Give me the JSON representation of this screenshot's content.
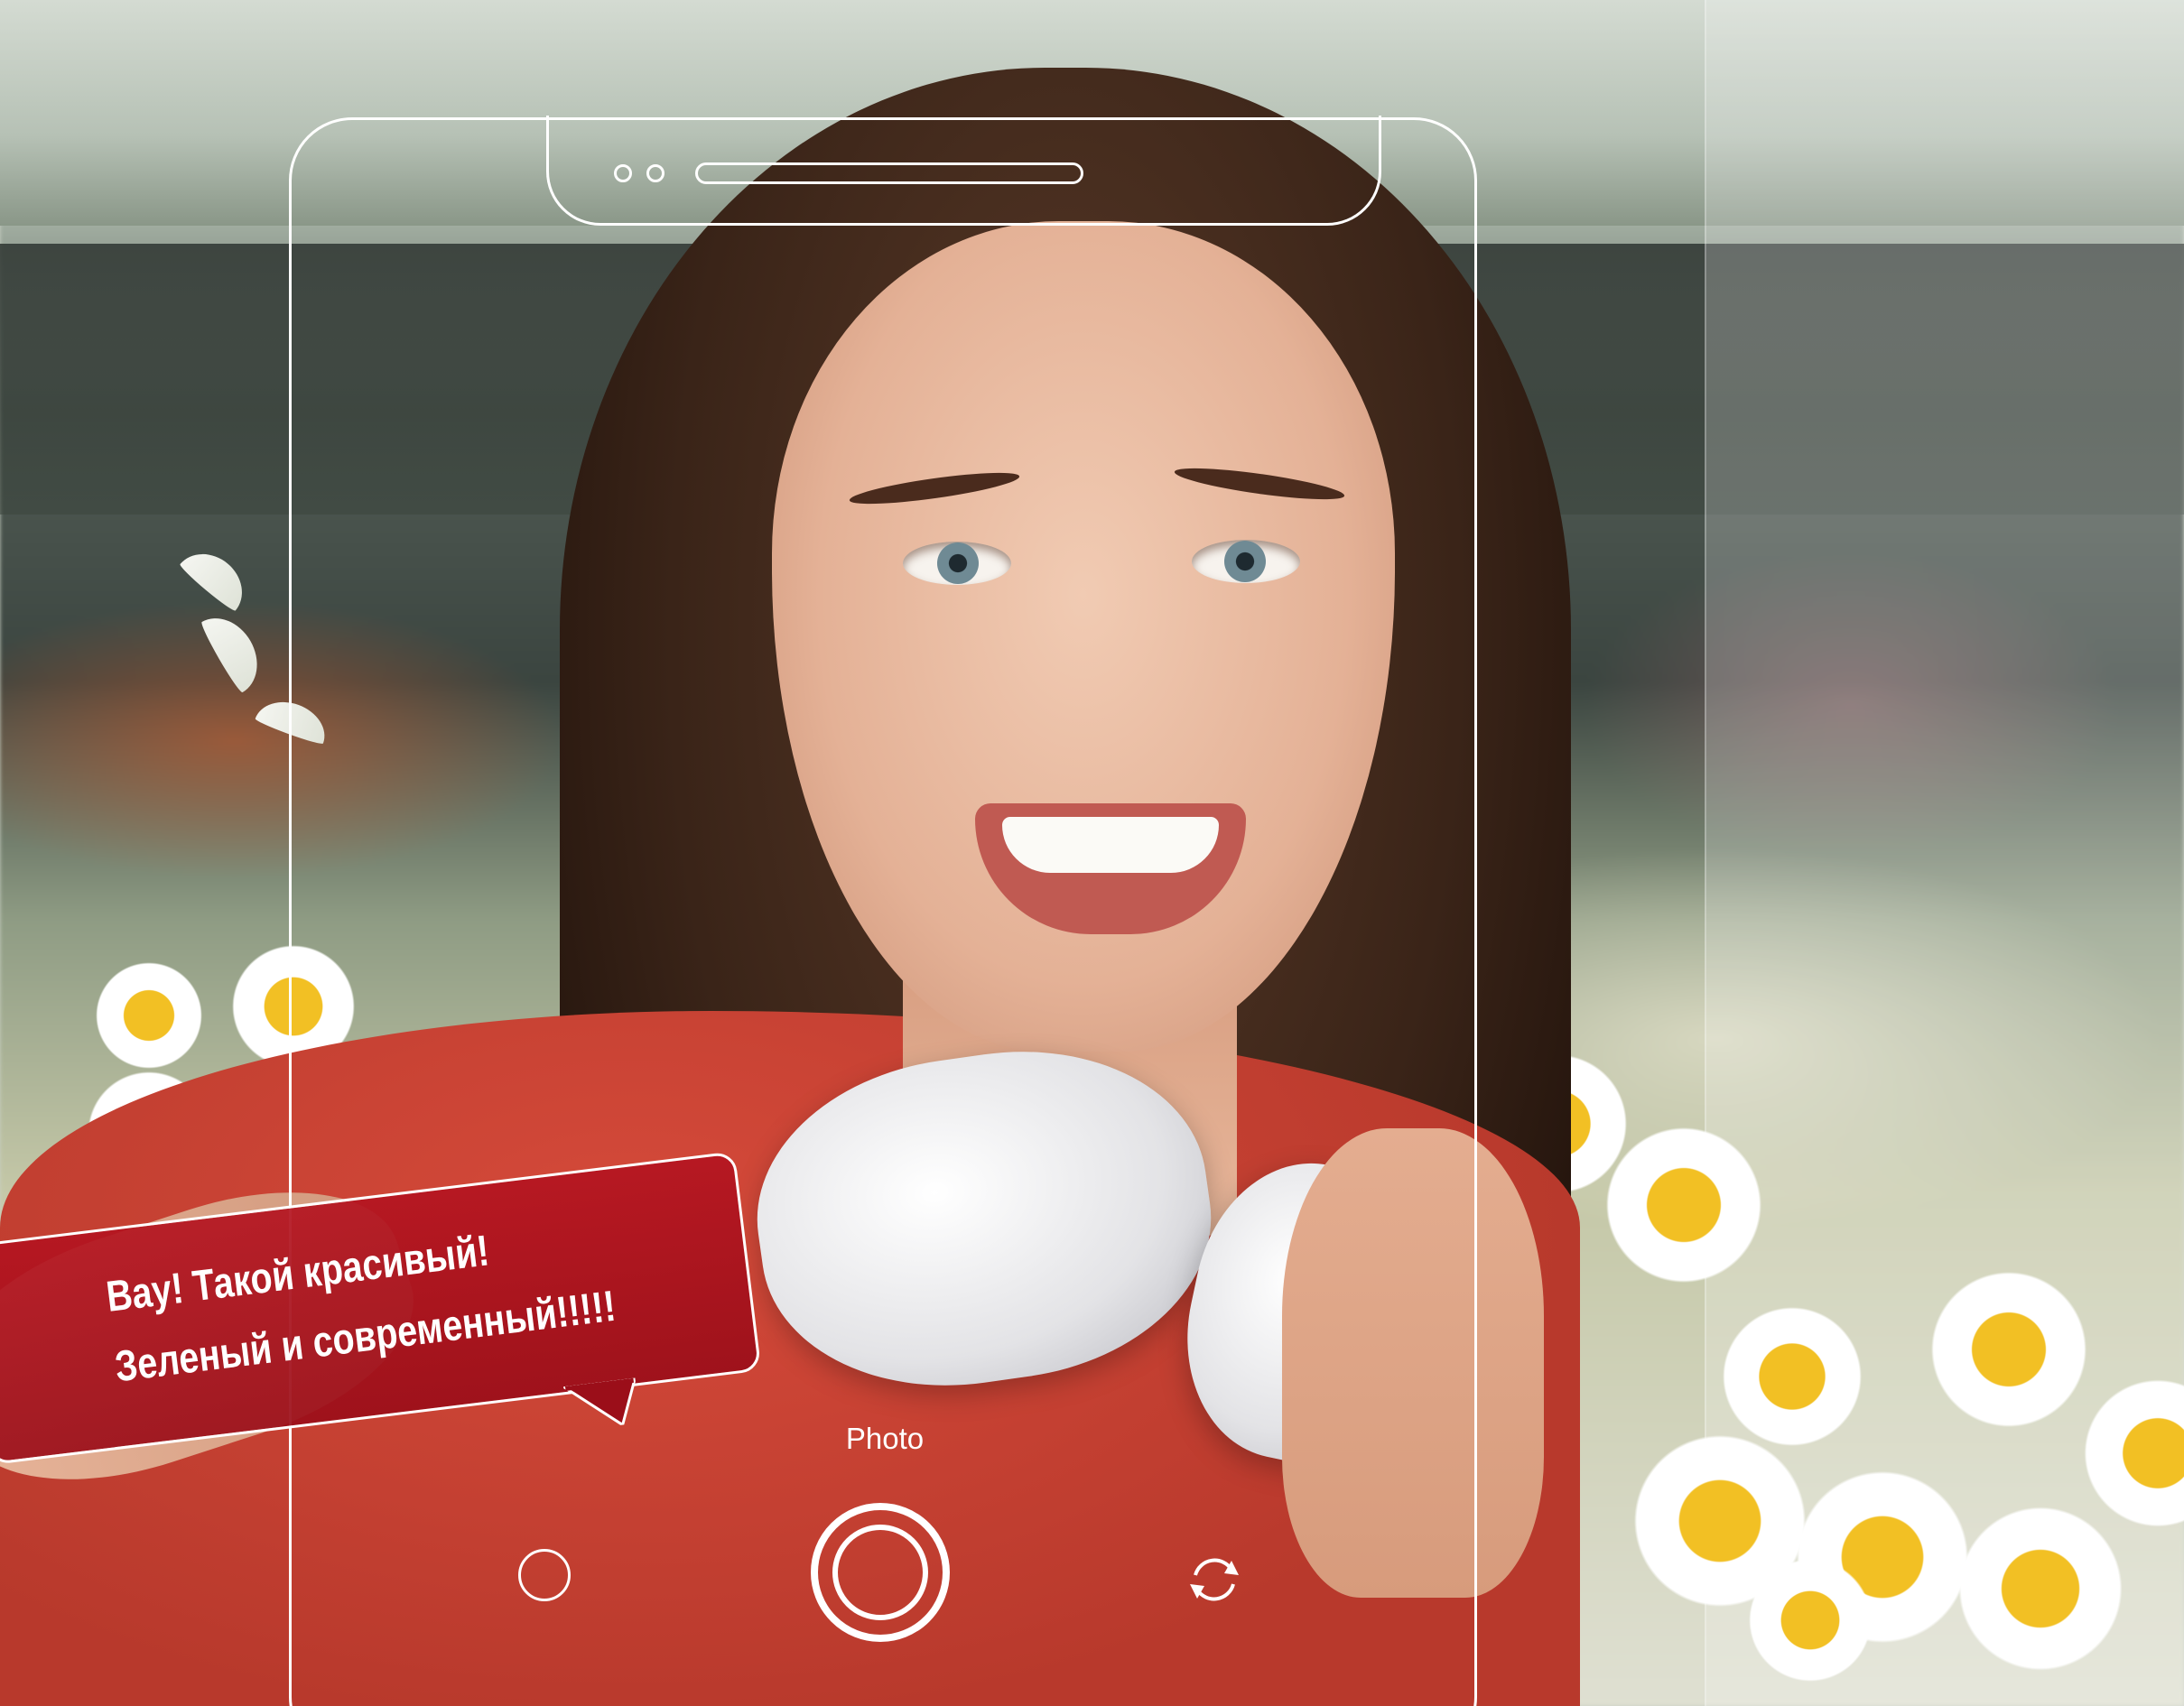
{
  "comment_bubble": {
    "line1": "Вау! Такой красивый!",
    "line2": "Зеленый и современный!!!!!",
    "color": "#b0141f"
  },
  "camera": {
    "mode_label": "Photo",
    "icons": {
      "gallery": "circle-icon",
      "shutter": "shutter-icon",
      "switch": "camera-switch-icon",
      "front_camera": "camera-dot-icon"
    }
  },
  "colors": {
    "frame": "#ffffff",
    "shirt": "#c8412f"
  }
}
